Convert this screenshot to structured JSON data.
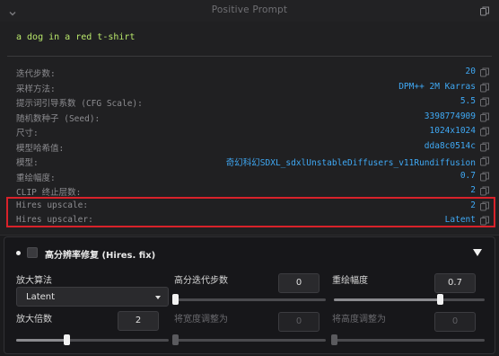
{
  "header": {
    "title": "Positive Prompt"
  },
  "prompt": {
    "text": "a dog in a red t-shirt"
  },
  "params": [
    {
      "label": "迭代步数:",
      "value": "20"
    },
    {
      "label": "采样方法:",
      "value": "DPM++ 2M Karras"
    },
    {
      "label": "提示词引导系数 (CFG Scale):",
      "value": "5.5"
    },
    {
      "label": "随机数种子 (Seed):",
      "value": "3398774909"
    },
    {
      "label": "尺寸:",
      "value": "1024x1024"
    },
    {
      "label": "模型哈希值:",
      "value": "dda8c0514c"
    },
    {
      "label": "模型:",
      "value": "奇幻科幻SDXL_sdxlUnstableDiffusers_v11Rundiffusion"
    },
    {
      "label": "重绘幅度:",
      "value": "0.7"
    },
    {
      "label": "CLIP 终止层数:",
      "value": "2"
    },
    {
      "label": "Hires upscale:",
      "value": "2"
    },
    {
      "label": "Hires upscaler:",
      "value": "Latent"
    }
  ],
  "hires": {
    "title": "高分辨率修复 (Hires. fix)",
    "enabled": false,
    "upscaler": {
      "label": "放大算法",
      "value": "Latent"
    },
    "steps": {
      "label": "高分迭代步数",
      "value": "0",
      "slider": 0.0
    },
    "denoise": {
      "label": "重绘幅度",
      "value": "0.7",
      "slider": 0.7
    },
    "scale": {
      "label": "放大倍数",
      "value": "2",
      "slider": 0.33
    },
    "resize_width": {
      "label": "将宽度调整为",
      "value": "0",
      "slider": 0.0
    },
    "resize_height": {
      "label": "将高度调整为",
      "value": "0",
      "slider": 0.0
    }
  },
  "colors": {
    "accent_value": "#3fa9f5",
    "prompt_text": "#b9e86b",
    "highlight": "#d8222a"
  }
}
